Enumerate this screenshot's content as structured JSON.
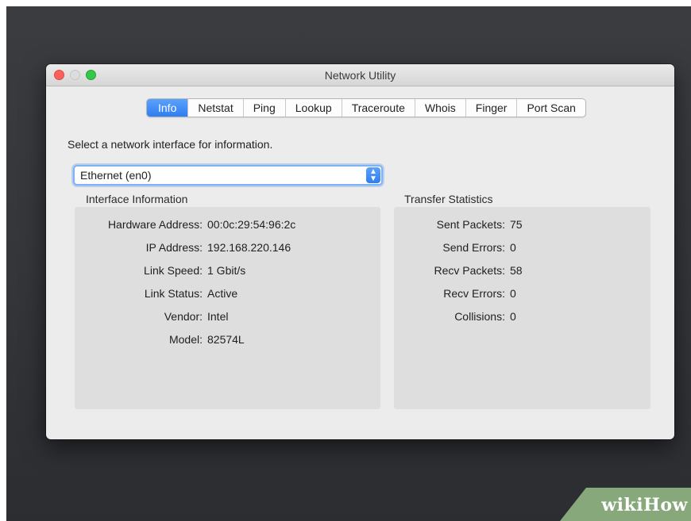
{
  "window": {
    "title": "Network Utility"
  },
  "tabs": [
    "Info",
    "Netstat",
    "Ping",
    "Lookup",
    "Traceroute",
    "Whois",
    "Finger",
    "Port Scan"
  ],
  "active_tab": "Info",
  "prompt": "Select a network interface for information.",
  "interface_select": {
    "value": "Ethernet (en0)"
  },
  "interface_info": {
    "label": "Interface Information",
    "rows": [
      {
        "key": "Hardware Address:",
        "value": "00:0c:29:54:96:2c"
      },
      {
        "key": "IP Address:",
        "value": "192.168.220.146"
      },
      {
        "key": "Link Speed:",
        "value": "1 Gbit/s"
      },
      {
        "key": "Link Status:",
        "value": "Active"
      },
      {
        "key": "Vendor:",
        "value": "Intel"
      },
      {
        "key": "Model:",
        "value": "82574L"
      }
    ]
  },
  "transfer_stats": {
    "label": "Transfer Statistics",
    "rows": [
      {
        "key": "Sent Packets:",
        "value": "75"
      },
      {
        "key": "Send Errors:",
        "value": "0"
      },
      {
        "key": "Recv Packets:",
        "value": "58"
      },
      {
        "key": "Recv Errors:",
        "value": "0"
      },
      {
        "key": "Collisions:",
        "value": "0"
      }
    ]
  },
  "watermark": {
    "part1": "wiki",
    "part2": "How"
  },
  "colors": {
    "accent": "#2f7ef2",
    "close": "#fc605b",
    "zoom": "#34c749",
    "watermark": "#86a87a"
  }
}
